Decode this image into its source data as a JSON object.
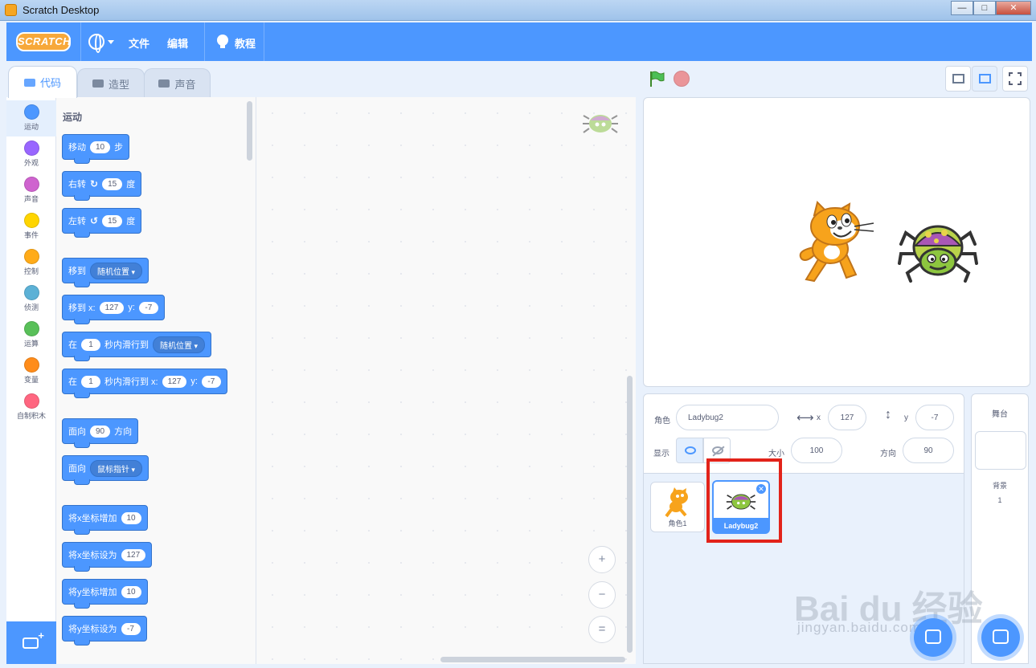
{
  "window": {
    "title": "Scratch Desktop"
  },
  "menubar": {
    "logo_text": "SCRATCH",
    "file": "文件",
    "edit": "编辑",
    "tutorials": "教程"
  },
  "tabs": {
    "code": "代码",
    "costumes": "造型",
    "sounds": "声音"
  },
  "categories": [
    {
      "label": "运动",
      "color": "#4c97ff"
    },
    {
      "label": "外观",
      "color": "#9966ff"
    },
    {
      "label": "声音",
      "color": "#cf63cf"
    },
    {
      "label": "事件",
      "color": "#ffd500"
    },
    {
      "label": "控制",
      "color": "#ffab19"
    },
    {
      "label": "侦测",
      "color": "#5cb1d6"
    },
    {
      "label": "运算",
      "color": "#59c059"
    },
    {
      "label": "变量",
      "color": "#ff8c1a"
    },
    {
      "label": "自制积木",
      "color": "#ff6680"
    }
  ],
  "palette": {
    "title": "运动",
    "move": {
      "a": "移动",
      "v": "10",
      "b": "步"
    },
    "turn_right": {
      "a": "右转",
      "v": "15",
      "b": "度"
    },
    "turn_left": {
      "a": "左转",
      "v": "15",
      "b": "度"
    },
    "goto": {
      "a": "移到",
      "dd": "随机位置"
    },
    "goto_xy": {
      "a": "移到 x:",
      "x": "127",
      "yl": "y:",
      "y": "-7"
    },
    "glide": {
      "a": "在",
      "v": "1",
      "b": "秒内滑行到",
      "dd": "随机位置"
    },
    "glide_xy": {
      "a": "在",
      "v": "1",
      "b": "秒内滑行到 x:",
      "x": "127",
      "yl": "y:",
      "y": "-7"
    },
    "point_dir": {
      "a": "面向",
      "v": "90",
      "b": "方向"
    },
    "point_towards": {
      "a": "面向",
      "dd": "鼠标指针"
    },
    "change_x": {
      "a": "将x坐标增加",
      "v": "10"
    },
    "set_x": {
      "a": "将x坐标设为",
      "v": "127"
    },
    "change_y": {
      "a": "将y坐标增加",
      "v": "10"
    },
    "set_y": {
      "a": "将y坐标设为",
      "v": "-7"
    }
  },
  "zoom": {
    "in": "+",
    "out": "−",
    "reset": "="
  },
  "sprite_info": {
    "sprite_label": "角色",
    "sprite_name": "Ladybug2",
    "x_label": "x",
    "x": "127",
    "y_label": "y",
    "y": "-7",
    "show_label": "显示",
    "size_label": "大小",
    "size": "100",
    "direction_label": "方向",
    "direction": "90"
  },
  "sprites": [
    {
      "name": "角色1",
      "selected": false
    },
    {
      "name": "Ladybug2",
      "selected": true
    }
  ],
  "stage_target": {
    "title": "舞台",
    "backdrops_label": "背景",
    "backdrops_count": "1"
  },
  "watermark": {
    "main": "Bai du 经验",
    "sub": "jingyan.baidu.com"
  }
}
